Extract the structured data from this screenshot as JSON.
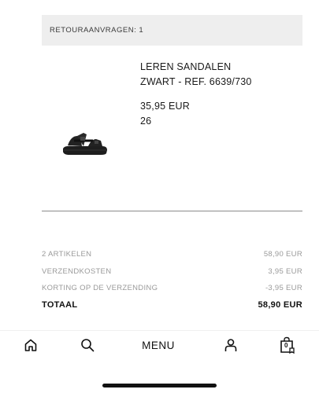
{
  "returns_banner": {
    "text": "RETOURAANVRAGEN: 1"
  },
  "product": {
    "name": "LEREN SANDALEN",
    "ref": "ZWART - REF. 6639/730",
    "price": "35,95 EUR",
    "size": "26",
    "image_icon": "sandal-image"
  },
  "summary": {
    "rows": [
      {
        "label": "2 ARTIKELEN",
        "value": "58,90 EUR"
      },
      {
        "label": "VERZENDKOSTEN",
        "value": "3,95 EUR"
      },
      {
        "label": "KORTING OP DE VERZENDING",
        "value": "-3,95 EUR"
      }
    ],
    "total": {
      "label": "TOTAAL",
      "value": "58,90 EUR"
    }
  },
  "bottom_nav": {
    "home_icon": "home-icon",
    "search_icon": "search-icon",
    "menu_label": "MENU",
    "account_icon": "user-icon",
    "cart_icon": "bag-icon",
    "cart_count": "0"
  }
}
